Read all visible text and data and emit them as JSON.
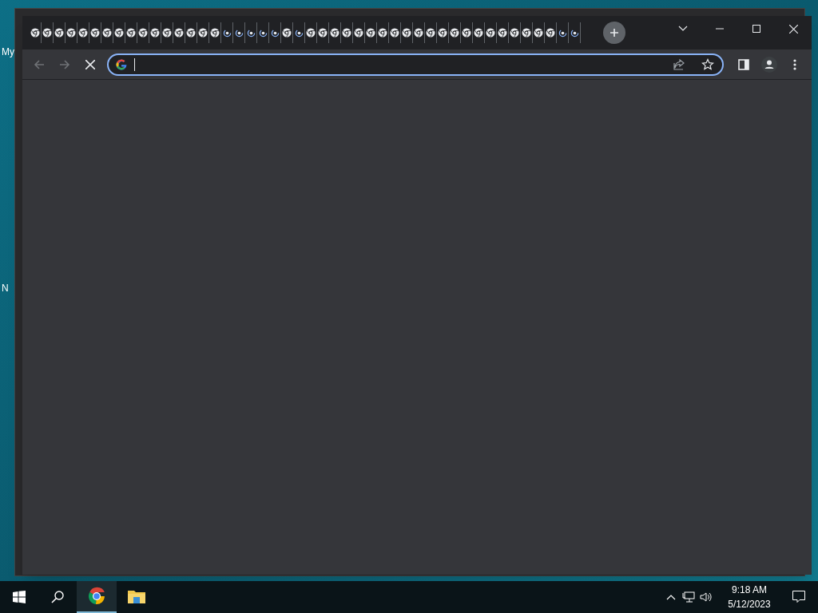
{
  "desktop_icons": [
    {
      "label": "My"
    },
    {
      "label": "N"
    }
  ],
  "browser": {
    "tabs": [
      {
        "loading": false
      },
      {
        "loading": false
      },
      {
        "loading": false
      },
      {
        "loading": false
      },
      {
        "loading": false
      },
      {
        "loading": false
      },
      {
        "loading": false
      },
      {
        "loading": false
      },
      {
        "loading": false
      },
      {
        "loading": false
      },
      {
        "loading": false
      },
      {
        "loading": false
      },
      {
        "loading": false
      },
      {
        "loading": false
      },
      {
        "loading": false
      },
      {
        "loading": false
      },
      {
        "loading": true
      },
      {
        "loading": true
      },
      {
        "loading": true
      },
      {
        "loading": true
      },
      {
        "loading": true
      },
      {
        "loading": false
      },
      {
        "loading": true
      },
      {
        "loading": false
      },
      {
        "loading": false
      },
      {
        "loading": false
      },
      {
        "loading": false
      },
      {
        "loading": false
      },
      {
        "loading": false
      },
      {
        "loading": false
      },
      {
        "loading": false
      },
      {
        "loading": false
      },
      {
        "loading": false
      },
      {
        "loading": false
      },
      {
        "loading": false
      },
      {
        "loading": false
      },
      {
        "loading": false
      },
      {
        "loading": false
      },
      {
        "loading": false
      },
      {
        "loading": false
      },
      {
        "loading": false
      },
      {
        "loading": false
      },
      {
        "loading": false
      },
      {
        "loading": false
      },
      {
        "loading": true
      },
      {
        "loading": true
      }
    ],
    "back_disabled": true,
    "forward_disabled": true,
    "omnibox_focused": true
  },
  "taskbar": {
    "apps": [
      {
        "kind": "chrome",
        "active": true
      },
      {
        "kind": "folder",
        "active": false
      }
    ],
    "time": "9:18 AM",
    "date": "5/12/2023"
  }
}
